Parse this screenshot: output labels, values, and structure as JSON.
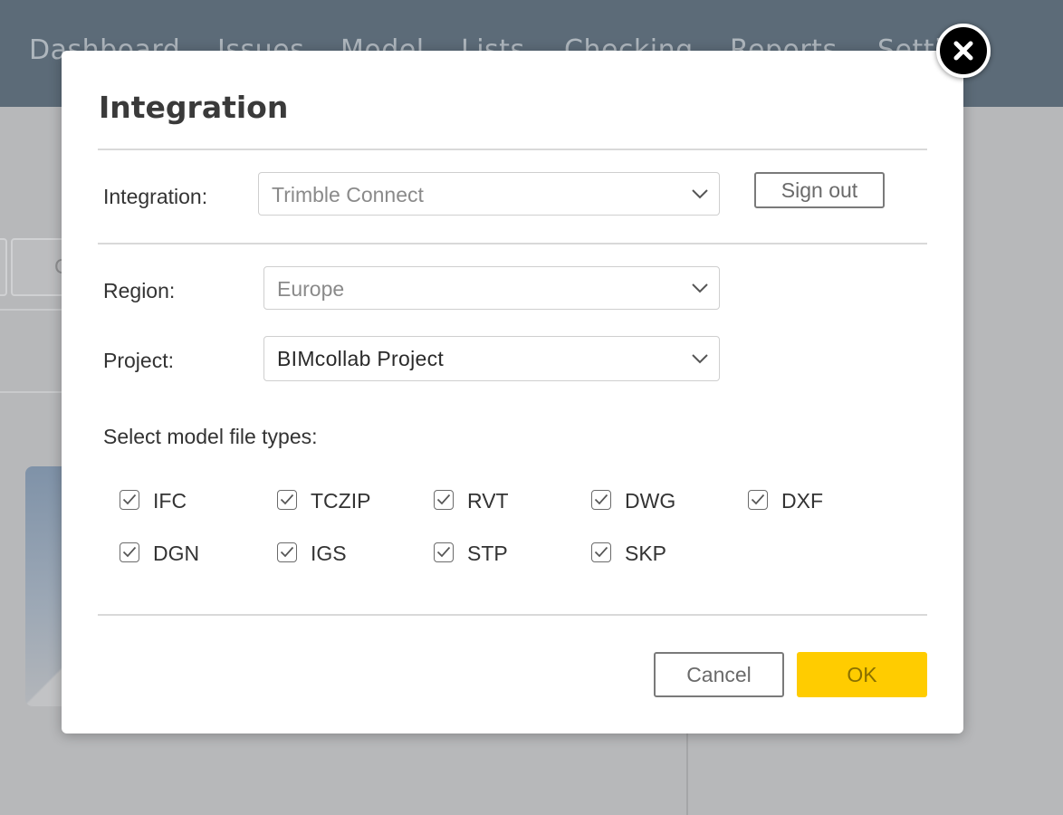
{
  "nav": {
    "items": [
      "Dashboard",
      "Issues",
      "Model",
      "Lists",
      "Checking",
      "Reports",
      "Settings"
    ]
  },
  "background": {
    "button_fragment": "C"
  },
  "dialog": {
    "title": "Integration",
    "integration_label": "Integration:",
    "integration_value": "Trimble Connect",
    "sign_out_label": "Sign out",
    "region_label": "Region:",
    "region_value": "Europe",
    "project_label": "Project:",
    "project_value": "BIMcollab Project",
    "file_types_label": "Select model file types:",
    "file_types": [
      {
        "label": "IFC",
        "checked": true
      },
      {
        "label": "TCZIP",
        "checked": true
      },
      {
        "label": "RVT",
        "checked": true
      },
      {
        "label": "DWG",
        "checked": true
      },
      {
        "label": "DXF",
        "checked": true
      },
      {
        "label": "DGN",
        "checked": true
      },
      {
        "label": "IGS",
        "checked": true
      },
      {
        "label": "STP",
        "checked": true
      },
      {
        "label": "SKP",
        "checked": true
      }
    ],
    "cancel_label": "Cancel",
    "ok_label": "OK"
  },
  "colors": {
    "nav_bg": "#5c6b78",
    "accent": "#ffcc00",
    "overlay": "#b7b8ba"
  },
  "icons": {
    "close": "close-icon",
    "dropdown": "chevron-down-icon",
    "check": "checkmark-icon"
  }
}
